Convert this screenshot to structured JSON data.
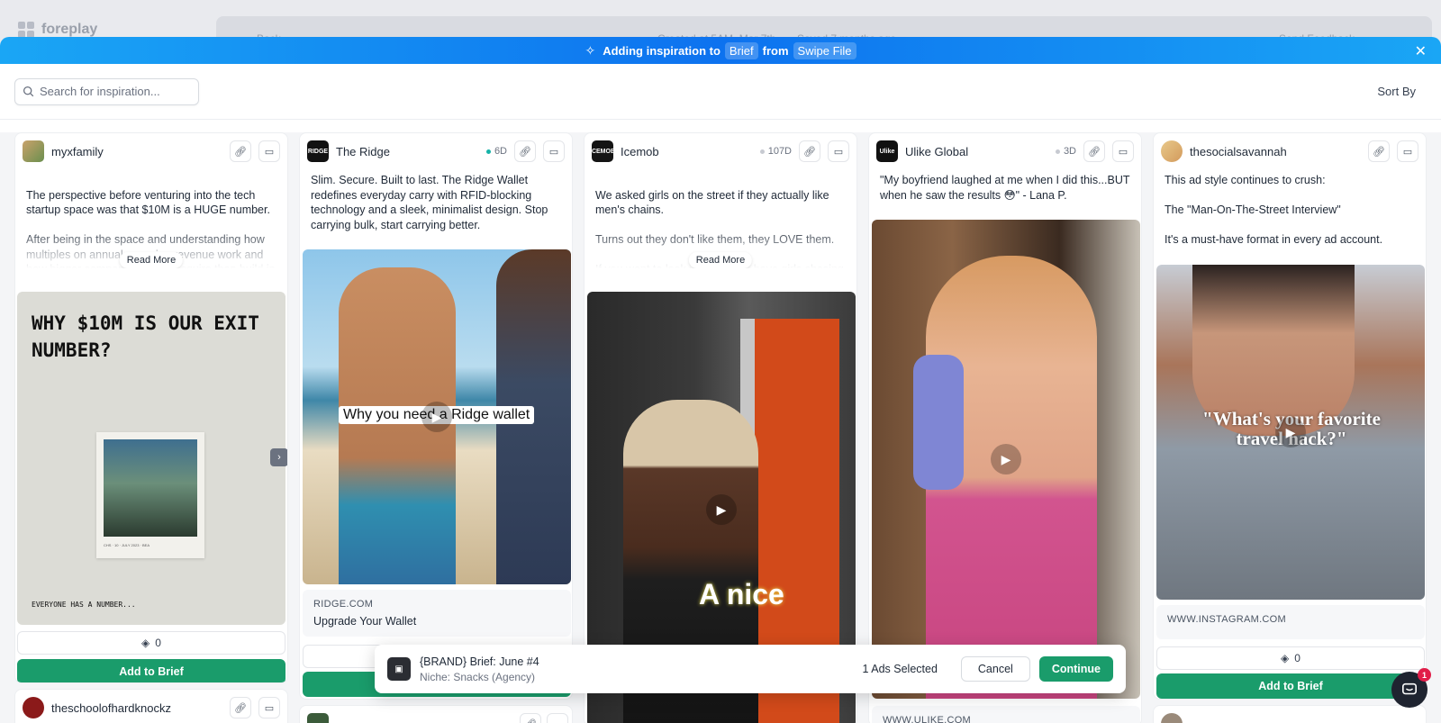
{
  "app": {
    "name": "foreplay"
  },
  "background": {
    "back": "Back",
    "created": "Created at 5AM, Mar 7th",
    "saved": "Saved 7 months ago",
    "feedback": "Send Feedback"
  },
  "banner": {
    "prefix": "Adding inspiration to",
    "target": "Brief",
    "from": "from",
    "source": "Swipe File"
  },
  "search": {
    "placeholder": "Search for inspiration..."
  },
  "sort_label": "Sort By",
  "cards": [
    {
      "brand": "myxfamily",
      "days": "",
      "text": "The perspective before venturing into the tech startup space was that $10M is a HUGE number.\n\nAfter being in the space and understanding how multiples on annual recurring revenue work and how bigger companies rather acquire than build in certain situations, I've gained clarity on the",
      "read_more": "Read More",
      "headline": "WHY $10M IS OUR EXIT NUMBER?",
      "footer": "EVERYONE HAS A NUMBER...",
      "photo_caption": "CHS · 10 · JULY 2023 · BEA",
      "count": "0",
      "add": "Add to Brief"
    },
    {
      "brand": "The Ridge",
      "days": "6D",
      "text": "Slim. Secure. Built to last. The Ridge Wallet redefines everyday carry with RFID-blocking technology and a sleek, minimalist design. Stop carrying bulk, start carrying better.",
      "caption": "Why you need a Ridge wallet",
      "url": "RIDGE.COM",
      "title": "Upgrade Your Wallet"
    },
    {
      "brand": "Icemob",
      "days": "107D",
      "text": "We asked girls on the street if they actually like men's chains.\n\nTurns out they don't like them, they LOVE them.\n\nIf you want to look iced out and have girls chasing you, you gotta check out our chains out.",
      "read_more": "Read More",
      "overlay": "A nice"
    },
    {
      "brand": "Ulike Global",
      "days": "3D",
      "text": "\"My boyfriend laughed at me when I did this...BUT when he saw the results 😳\" - Lana P.",
      "url": "WWW.ULIKE.COM"
    },
    {
      "brand": "thesocialsavannah",
      "days": "",
      "text": "This ad style continues to crush:\n\nThe \"Man-On-The-Street Interview\"\n\nIt's a must-have format in every ad account.",
      "caption": "\"What's your favorite travel hack?\"",
      "url": "WWW.INSTAGRAM.COM",
      "count": "0",
      "add": "Add to Brief"
    }
  ],
  "next_card_brand": "theschoolofhardknockz",
  "selection": {
    "brief": "{BRAND} Brief: June #4",
    "niche": "Niche: Snacks (Agency)",
    "count": "1 Ads Selected",
    "cancel": "Cancel",
    "continue": "Continue"
  },
  "chat_badge": "1",
  "colors": {
    "accent": "#1a9c6b",
    "banner_blue": "#0d72ef",
    "dot_ridge": "#16b3a8",
    "dot_other": "#c7cad1"
  },
  "icons": [
    "link-icon",
    "save-icon",
    "search-icon",
    "close-icon",
    "play-icon",
    "layers-icon",
    "chevron-right-icon",
    "chat-icon"
  ]
}
